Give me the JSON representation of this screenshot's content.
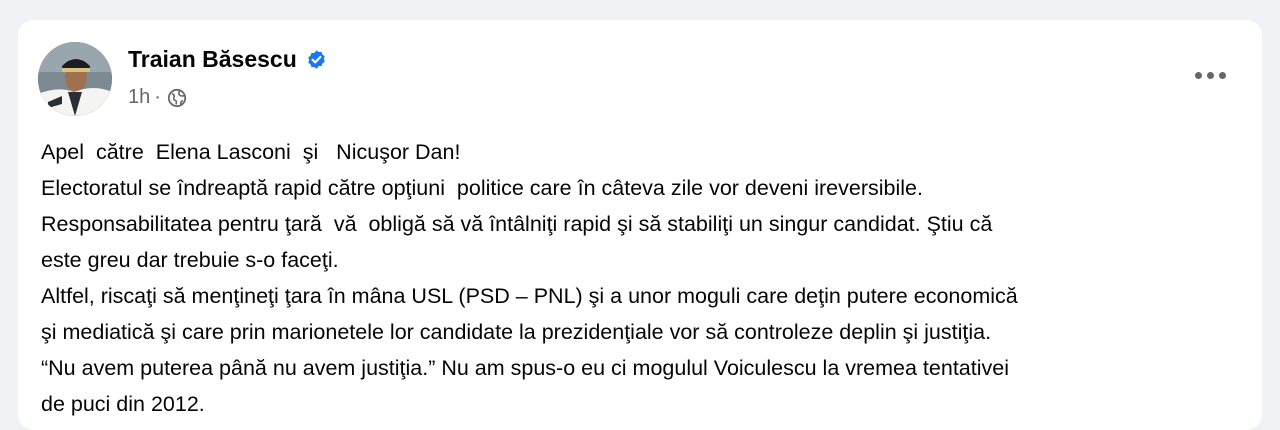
{
  "post": {
    "author": "Traian Băsescu",
    "time": "1h",
    "separator": "·",
    "visibility_icon": "globe-icon",
    "verified_icon": "verified-badge-icon",
    "more_icon": "more-options-icon",
    "lines": [
      "Apel  către  Elena Lasconi  şi   Nicuşor Dan!",
      "Electoratul se îndreaptă rapid către opţiuni  politice care în câteva zile vor deveni ireversibile.",
      "Responsabilitatea pentru ţară  vă  obligă să vă întâlniţi rapid şi să stabiliţi un singur candidat. Ştiu că",
      "este greu dar trebuie s-o faceţi.",
      "Altfel, riscaţi să menţineţi ţara în mâna USL (PSD – PNL) şi a unor moguli care deţin putere economică",
      "şi mediatică şi care prin marionetele lor candidate la prezidenţiale vor să controleze deplin şi justiţia.",
      "“Nu avem puterea până nu avem justiţia.” Nu am spus-o eu ci mogulul Voiculescu la vremea tentativei",
      "de puci din 2012."
    ]
  },
  "colors": {
    "background": "#f0f2f5",
    "card": "#ffffff",
    "text_primary": "#050505",
    "text_secondary": "#65676b",
    "verified_blue": "#1877f2"
  }
}
